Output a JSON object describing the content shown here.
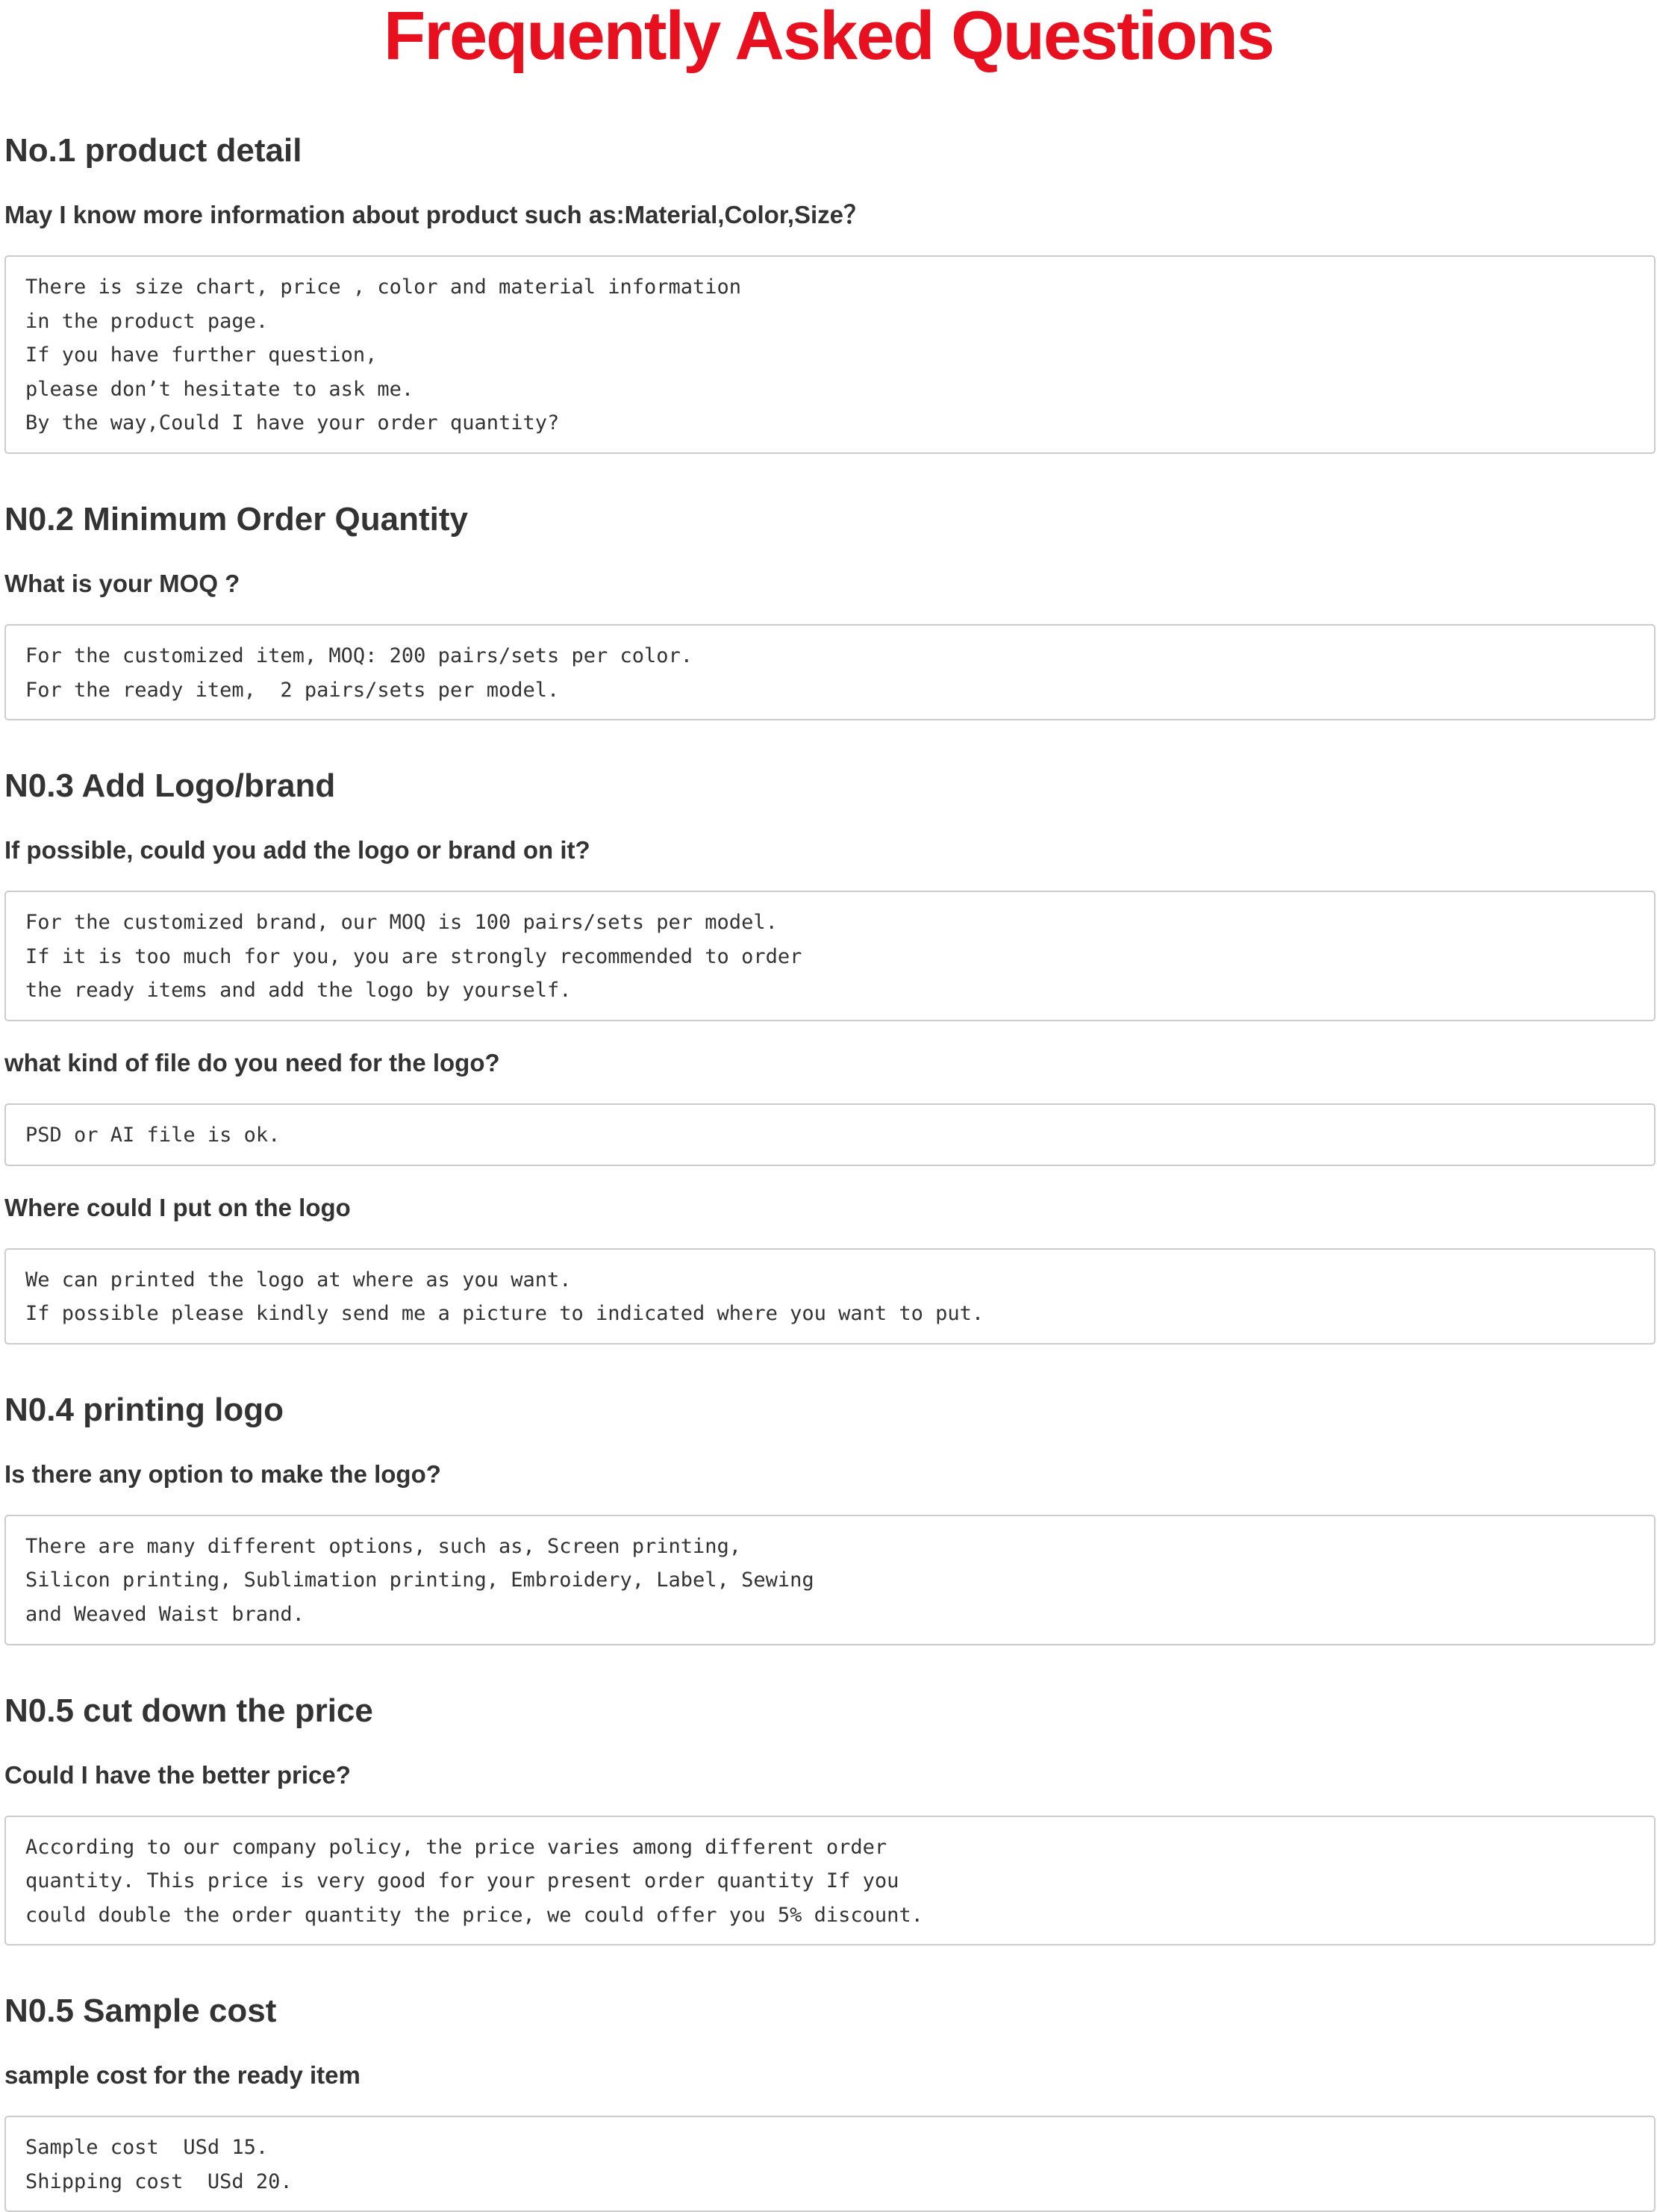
{
  "page": {
    "title": "Frequently Asked Questions",
    "title_color": "#e8101e",
    "text_color": "#333333",
    "box_border_color": "#cccccc"
  },
  "sections": [
    {
      "heading": "No.1 product detail",
      "items": [
        {
          "question": "May I know more information about product such as:Material,Color,Size？",
          "answer": [
            "There is size chart, price , color and material information",
            "in the product page.",
            "If you have further question,",
            "please don’t hesitate to ask me.",
            "By the way,Could I have your order quantity?"
          ]
        }
      ]
    },
    {
      "heading": "N0.2 Minimum Order Quantity",
      "items": [
        {
          "question": "What is your MOQ ?",
          "answer": [
            "For the customized item, MOQ: 200 pairs/sets per color.",
            "For the ready item,  2 pairs/sets per model."
          ]
        }
      ]
    },
    {
      "heading": "N0.3 Add Logo/brand",
      "items": [
        {
          "question": "If possible, could you add the logo or brand on it?",
          "answer": [
            "For the customized brand, our MOQ is 100 pairs/sets per model.",
            "If it is too much for you, you are strongly recommended to order",
            "the ready items and add the logo by yourself."
          ]
        },
        {
          "question": "what kind of file do you need for the logo?",
          "answer": [
            "PSD or AI file is ok."
          ]
        },
        {
          "question": "Where could I put on the logo",
          "answer": [
            "We can printed the logo at where as you want.",
            "If possible please kindly send me a picture to indicated where you want to put."
          ]
        }
      ]
    },
    {
      "heading": "N0.4 printing logo",
      "items": [
        {
          "question": "Is there any option to make the logo?",
          "answer": [
            "There are many different options, such as, Screen printing,",
            "Silicon printing, Sublimation printing, Embroidery, Label, Sewing",
            "and Weaved Waist brand."
          ]
        }
      ]
    },
    {
      "heading": "N0.5 cut down the price",
      "items": [
        {
          "question": "Could I have the better price?",
          "answer": [
            "According to our company policy, the price varies among different order",
            "quantity. This price is very good for your present order quantity If you",
            "could double the order quantity the price, we could offer you 5% discount."
          ]
        }
      ]
    },
    {
      "heading": "N0.5 Sample cost",
      "items": [
        {
          "question": "sample cost for the ready item",
          "answer": [
            "Sample cost  USd 15.",
            "Shipping cost  USd 20."
          ]
        }
      ]
    }
  ]
}
